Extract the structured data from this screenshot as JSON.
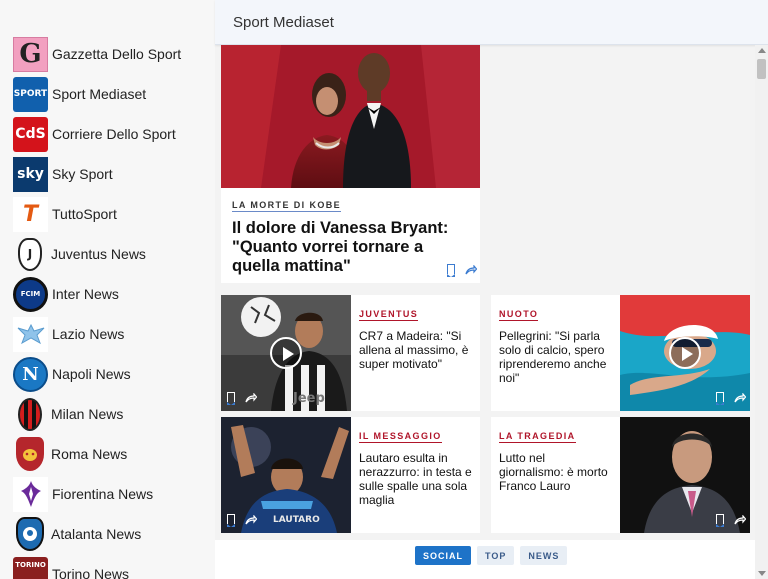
{
  "header": {
    "title": "Sport Mediaset"
  },
  "sidebar": {
    "items": [
      {
        "label": "Gazzetta Dello Sport",
        "logo_text": "G"
      },
      {
        "label": "Sport Mediaset",
        "logo_text": "SPORT"
      },
      {
        "label": "Corriere Dello Sport",
        "logo_text": "CdS"
      },
      {
        "label": "Sky Sport",
        "logo_text": "sky"
      },
      {
        "label": "TuttoSport",
        "logo_text": "T"
      },
      {
        "label": "Juventus News",
        "logo_text": "J"
      },
      {
        "label": "Inter News",
        "logo_text": "FCIM"
      },
      {
        "label": "Lazio News",
        "logo_text": ""
      },
      {
        "label": "Napoli News",
        "logo_text": "N"
      },
      {
        "label": "Milan News",
        "logo_text": ""
      },
      {
        "label": "Roma News",
        "logo_text": ""
      },
      {
        "label": "Fiorentina News",
        "logo_text": ""
      },
      {
        "label": "Atalanta News",
        "logo_text": ""
      },
      {
        "label": "Torino News",
        "logo_text": "TORINO"
      }
    ]
  },
  "feature": {
    "kicker": "LA MORTE DI KOBE",
    "title": "Il dolore di Vanessa Bryant: \"Quanto vorrei tornare a quella mattina\""
  },
  "cards": [
    {
      "kicker": "JUVENTUS",
      "title": "CR7 a Madeira: \"Si allena al massimo, è super motivato\"",
      "video": true
    },
    {
      "kicker": "NUOTO",
      "title": "Pellegrini: \"Si parla solo di calcio, spero riprenderemo anche noi\"",
      "video": true
    },
    {
      "kicker": "IL MESSAGGIO",
      "title": "Lautaro esulta in nerazzurro: in testa e sulle spalle una sola maglia",
      "video": false
    },
    {
      "kicker": "LA TRAGEDIA",
      "title": "Lutto nel giornalismo: è morto Franco Lauro",
      "video": false
    }
  ],
  "tabs": [
    {
      "label": "SOCIAL",
      "active": true
    },
    {
      "label": "TOP",
      "active": false
    },
    {
      "label": "NEWS",
      "active": false
    }
  ],
  "icons": {
    "bookmark": "bookmark-icon",
    "share": "share-icon",
    "play": "play-icon"
  },
  "colors": {
    "accent_red": "#b0152a",
    "tab_active": "#1e73c8",
    "header_bg": "#f3f6fb"
  }
}
